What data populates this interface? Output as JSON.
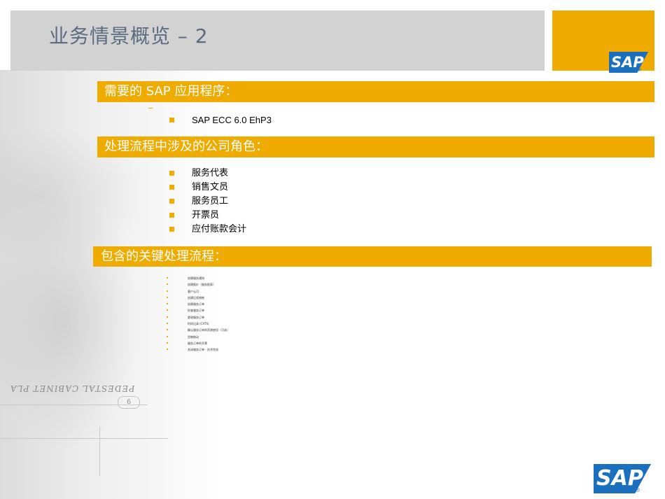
{
  "title": "业务情景概览 – 2",
  "logo": {
    "text": "SAP",
    "reg_mark": "®",
    "color": "#1a6fbf"
  },
  "accent_color": "#f0ab00",
  "sections": {
    "applications": {
      "heading": "需要的 SAP 应用程序：",
      "items": [
        "SAP ECC 6.0 EhP3"
      ]
    },
    "roles": {
      "heading": "处理流程中涉及的公司角色：",
      "items": [
        "服务代表",
        "销售文员",
        "服务员工",
        "开票员",
        "应付账款会计"
      ]
    },
    "processes": {
      "heading": "包含的关键处理流程：",
      "items": [
        "创建服务通知",
        "创建报价（服务报表）",
        "客户认可",
        "创建后续销售",
        "创建服务订单",
        "检查服务订单",
        "更改服务订单",
        "时间记录 (CATS)",
        "确认服务订单的资源使用（可选）",
        "货物移动",
        "服务订单的开票",
        "关闭服务订单 - 技术完成"
      ]
    }
  },
  "photo": {
    "caption_text": "PEDESTAL CABINET PLA",
    "sheet_number": "6"
  }
}
